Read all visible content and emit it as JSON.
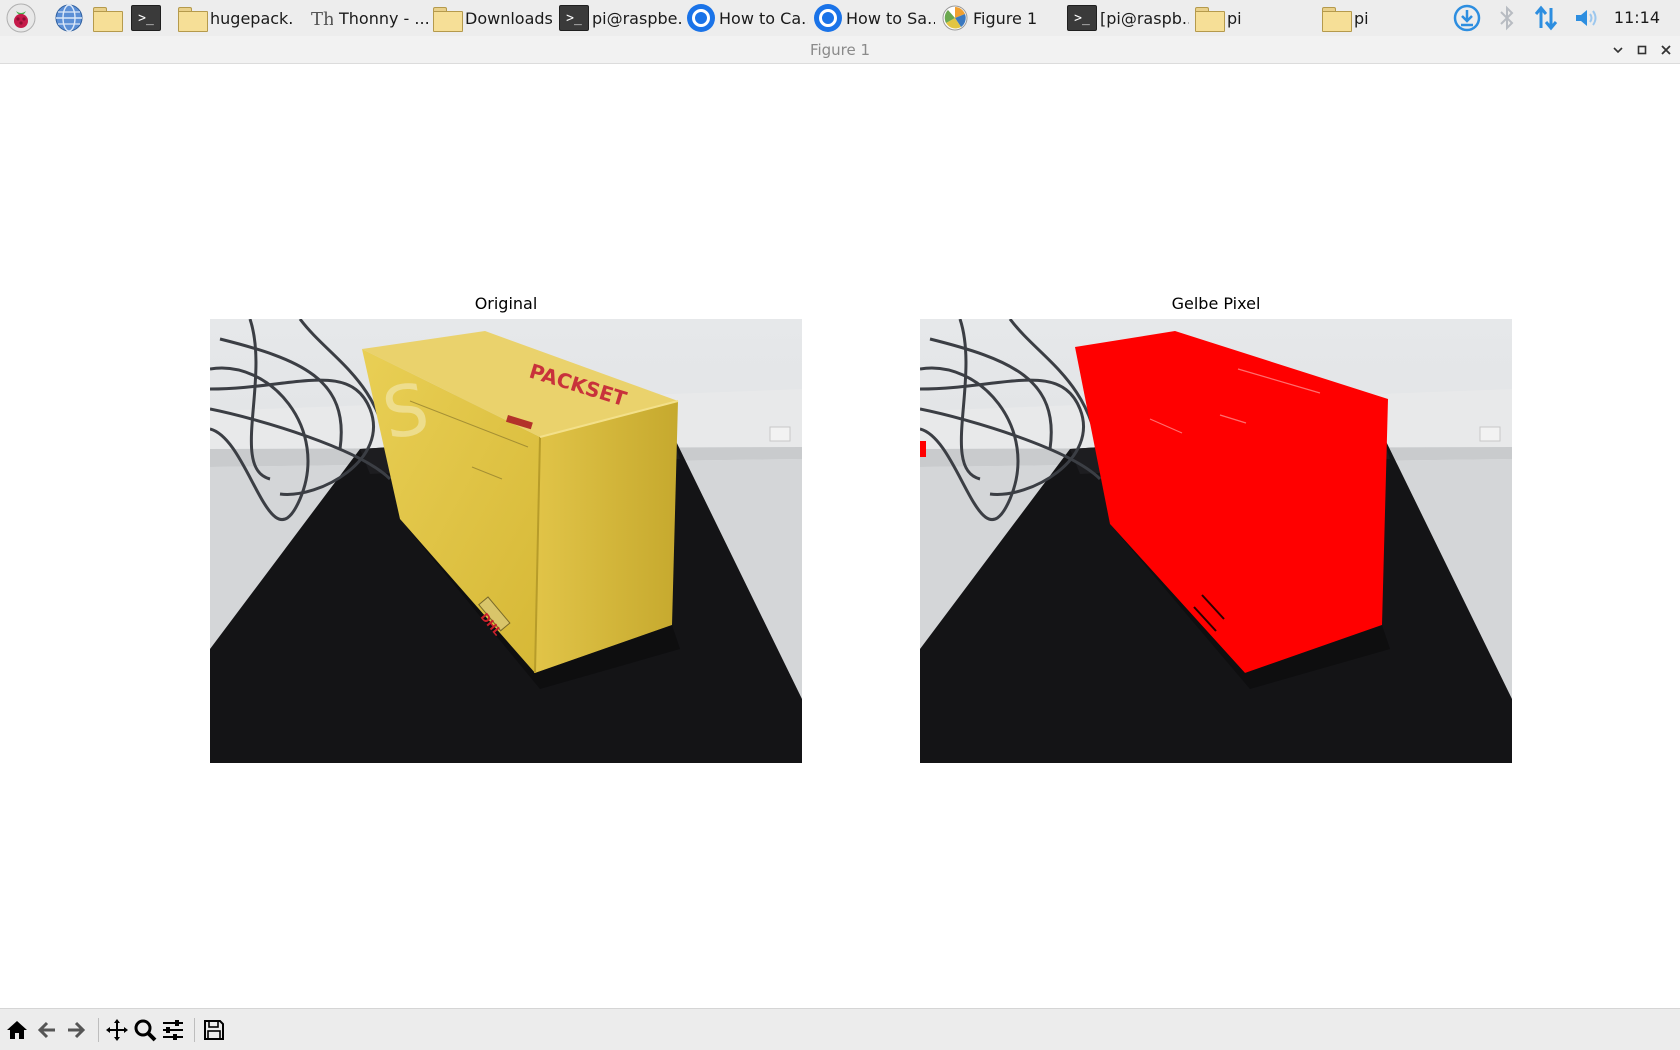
{
  "taskbar": {
    "launchers": [
      {
        "icon": "raspberry-menu-icon"
      },
      {
        "icon": "web-browser-icon"
      },
      {
        "icon": "file-manager-icon"
      },
      {
        "icon": "terminal-icon"
      }
    ],
    "tasks": [
      {
        "label": "hugepack...",
        "icon": "folder-icon"
      },
      {
        "label": "Thonny  -  ...",
        "icon": "thonny-icon"
      },
      {
        "label": "Downloads",
        "icon": "folder-icon"
      },
      {
        "label": "pi@raspbe...",
        "icon": "terminal-icon"
      },
      {
        "label": "How to Ca...",
        "icon": "chromium-icon"
      },
      {
        "label": "How to Sa...",
        "icon": "chromium-icon"
      },
      {
        "label": "Figure 1",
        "icon": "matplotlib-icon"
      },
      {
        "label": "[pi@raspb...",
        "icon": "terminal-icon"
      },
      {
        "label": "pi",
        "icon": "folder-icon"
      },
      {
        "label": "pi",
        "icon": "folder-icon"
      }
    ],
    "tray": [
      {
        "icon": "download-icon"
      },
      {
        "icon": "bluetooth-icon"
      },
      {
        "icon": "network-icon"
      },
      {
        "icon": "volume-icon"
      }
    ],
    "clock": "11:14"
  },
  "window": {
    "title": "Figure 1",
    "controls": [
      "minimize-icon",
      "maximize-icon",
      "close-icon"
    ]
  },
  "figure": {
    "subplots": [
      {
        "title": "Original",
        "image": "photo of yellow PACKSET box on black table"
      },
      {
        "title": "Gelbe Pixel",
        "image": "same photo with yellow pixels replaced by red"
      }
    ],
    "box_text": {
      "brand": "PACKSET",
      "side_letter": "S",
      "carrier": "DHL"
    },
    "colors": {
      "box_yellow": "#e3c94a",
      "mask_red": "#ff0000",
      "table_black": "#141416",
      "wall": "#dfe1e3"
    }
  },
  "toolbar": {
    "tools": [
      {
        "icon": "home-icon"
      },
      {
        "icon": "back-arrow-icon"
      },
      {
        "icon": "forward-arrow-icon"
      },
      {
        "icon": "pan-icon"
      },
      {
        "icon": "zoom-icon"
      },
      {
        "icon": "subplots-config-icon"
      },
      {
        "icon": "save-icon"
      }
    ]
  }
}
